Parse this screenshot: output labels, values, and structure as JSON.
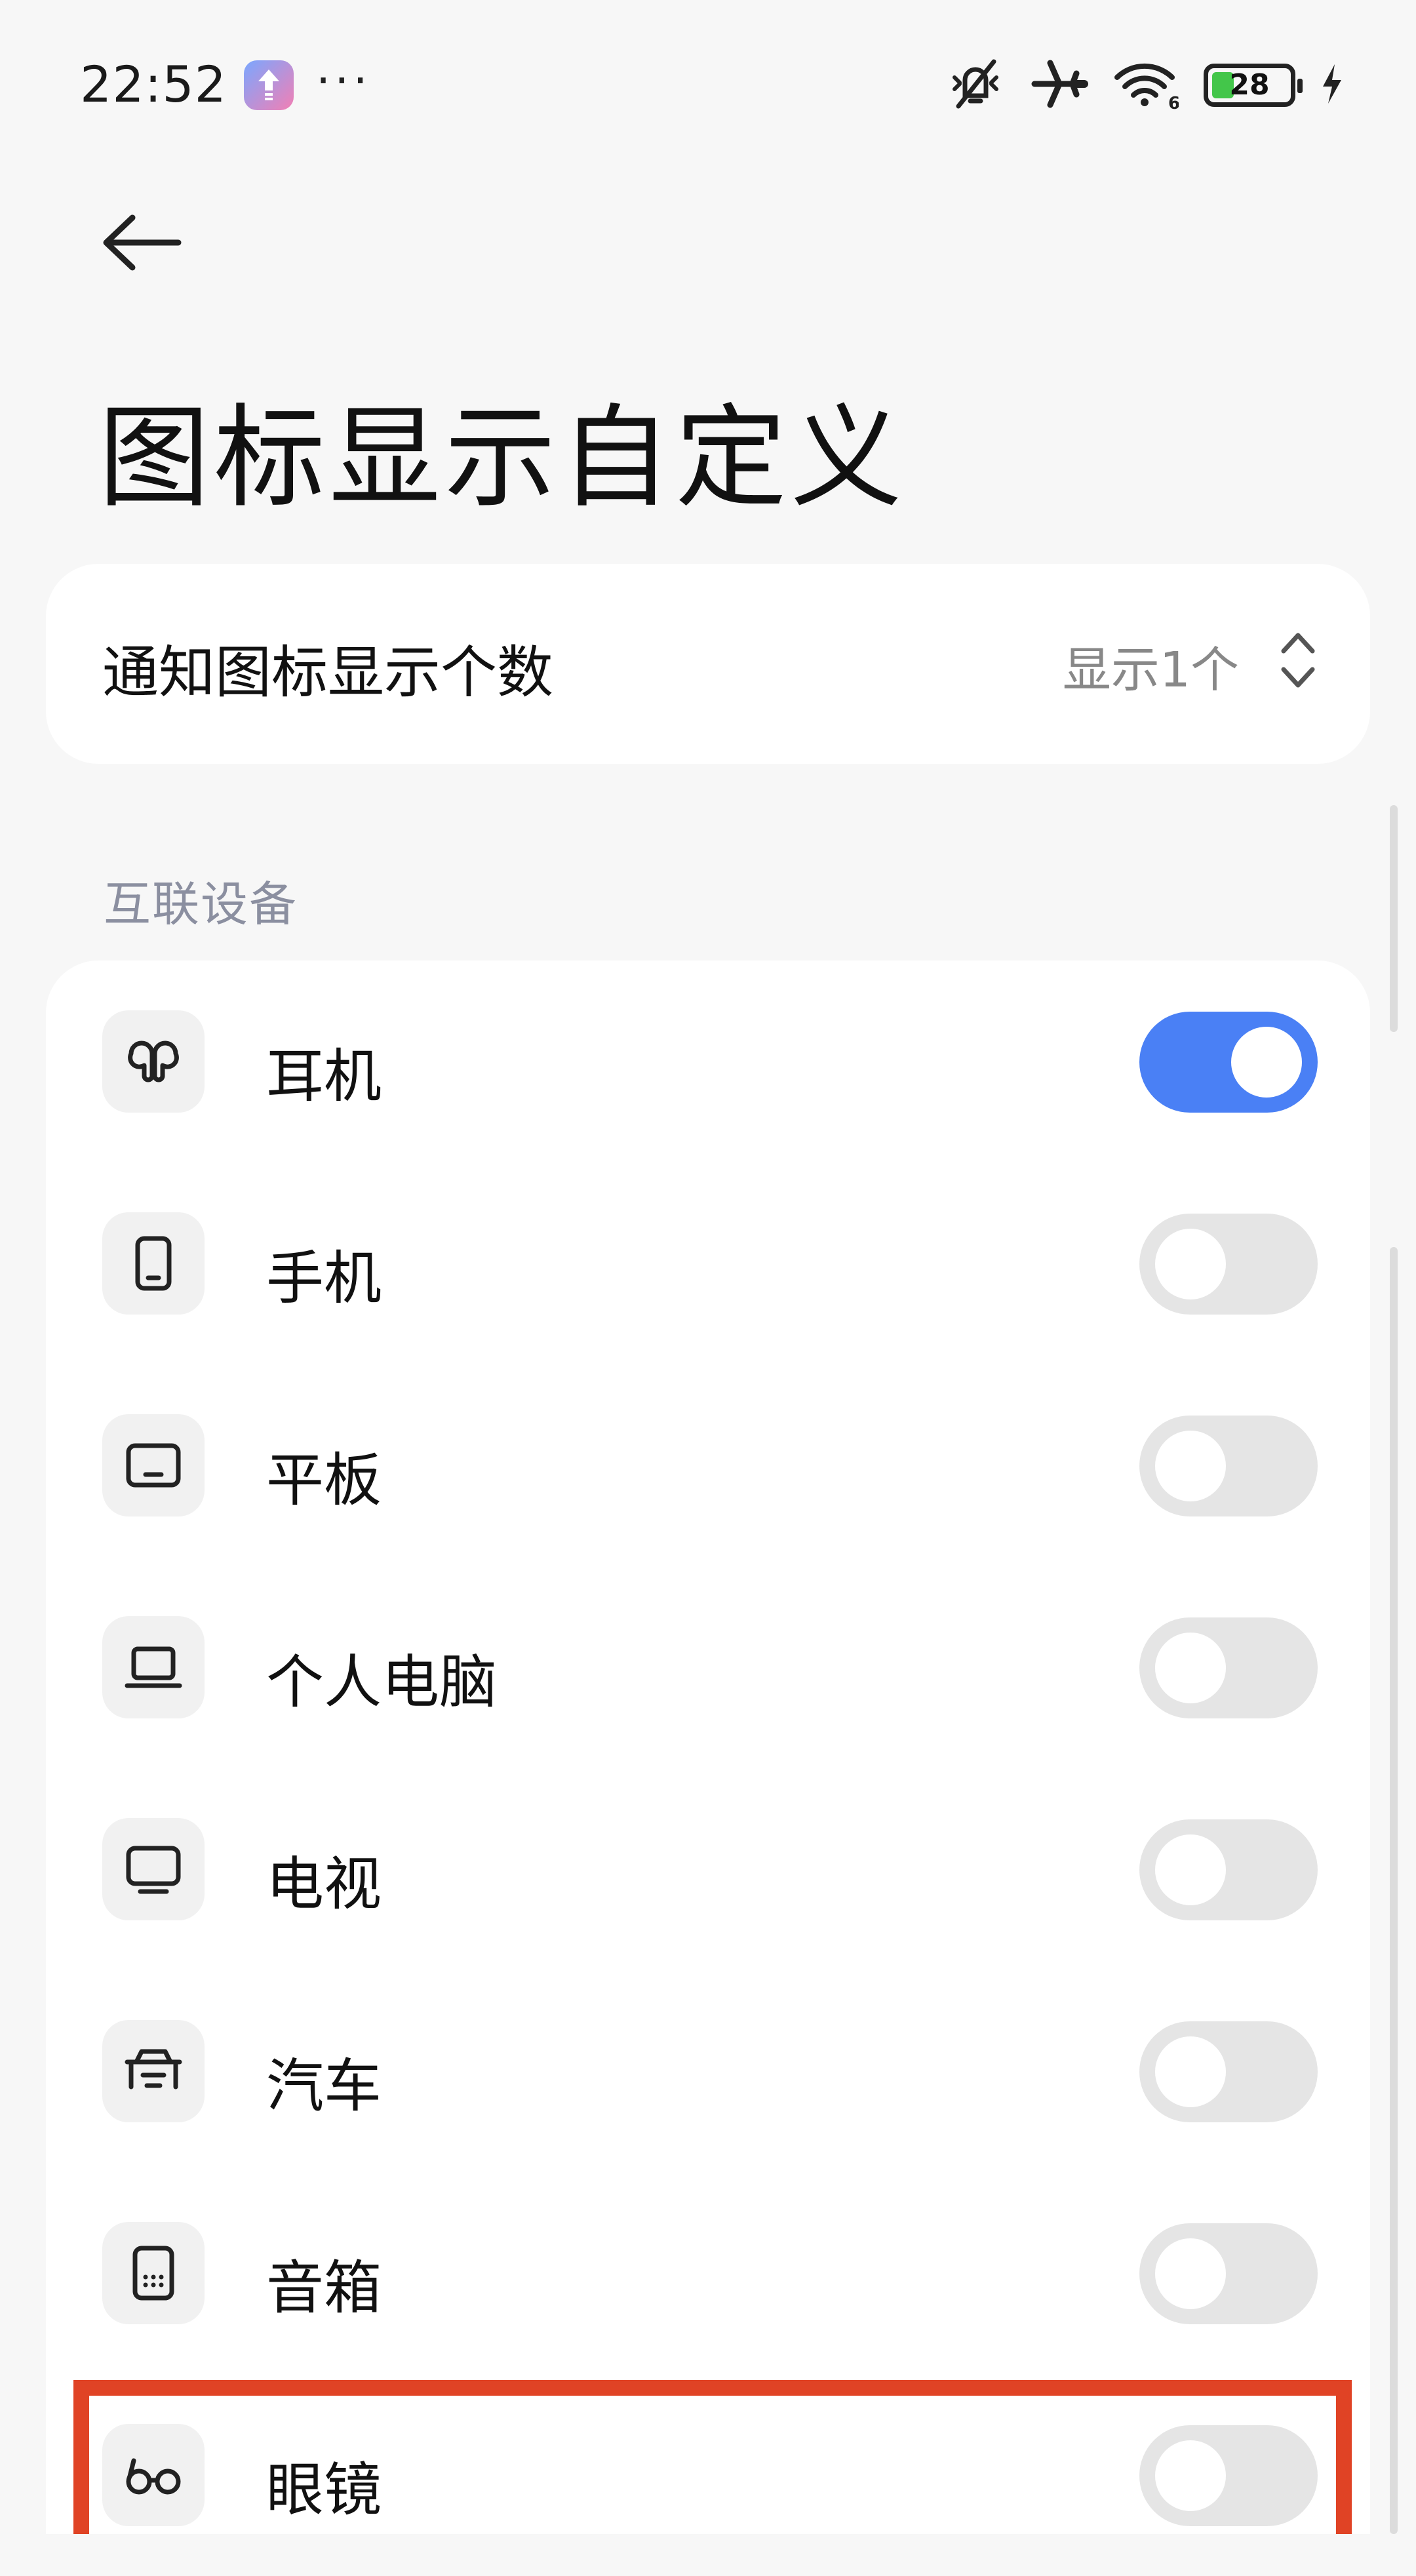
{
  "status_bar": {
    "time": "22:52",
    "more": "···",
    "battery_level": "28",
    "icons": [
      "mute-icon",
      "airplane-icon",
      "wifi-icon",
      "battery-icon",
      "charging-icon"
    ]
  },
  "page": {
    "title": "图标显示自定义"
  },
  "notification_setting": {
    "label": "通知图标显示个数",
    "value": "显示1个"
  },
  "devices": {
    "section_title": "互联设备",
    "items": [
      {
        "label": "耳机",
        "icon": "earbuds-icon",
        "enabled": true
      },
      {
        "label": "手机",
        "icon": "phone-icon",
        "enabled": false
      },
      {
        "label": "平板",
        "icon": "tablet-icon",
        "enabled": false
      },
      {
        "label": "个人电脑",
        "icon": "laptop-icon",
        "enabled": false
      },
      {
        "label": "电视",
        "icon": "tv-icon",
        "enabled": false
      },
      {
        "label": "汽车",
        "icon": "car-icon",
        "enabled": false
      },
      {
        "label": "音箱",
        "icon": "speaker-icon",
        "enabled": false
      },
      {
        "label": "眼镜",
        "icon": "glasses-icon",
        "enabled": false
      }
    ]
  },
  "colors": {
    "background": "#f7f7f7",
    "card": "#ffffff",
    "toggle_on": "#4a80f5",
    "toggle_off": "#e5e5e5",
    "highlight": "#e04325"
  }
}
